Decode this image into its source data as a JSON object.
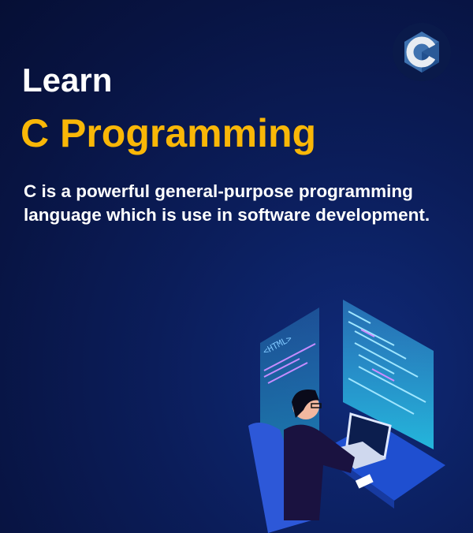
{
  "header": {
    "line1": "Learn",
    "line2": "C Programming"
  },
  "description": {
    "line1": "C is a powerful general-purpose programming",
    "line2": "language which is use in software development."
  },
  "logo": {
    "icon": "c-language-hexagon-logo",
    "letter": "C"
  },
  "illustration": {
    "screen_label": "<HTML>",
    "icon": "programmer-at-laptop-illustration"
  },
  "colors": {
    "background": "#0b1d5a",
    "accent": "#f9b707",
    "text": "#ffffff",
    "screen": "#2bb7e8"
  }
}
